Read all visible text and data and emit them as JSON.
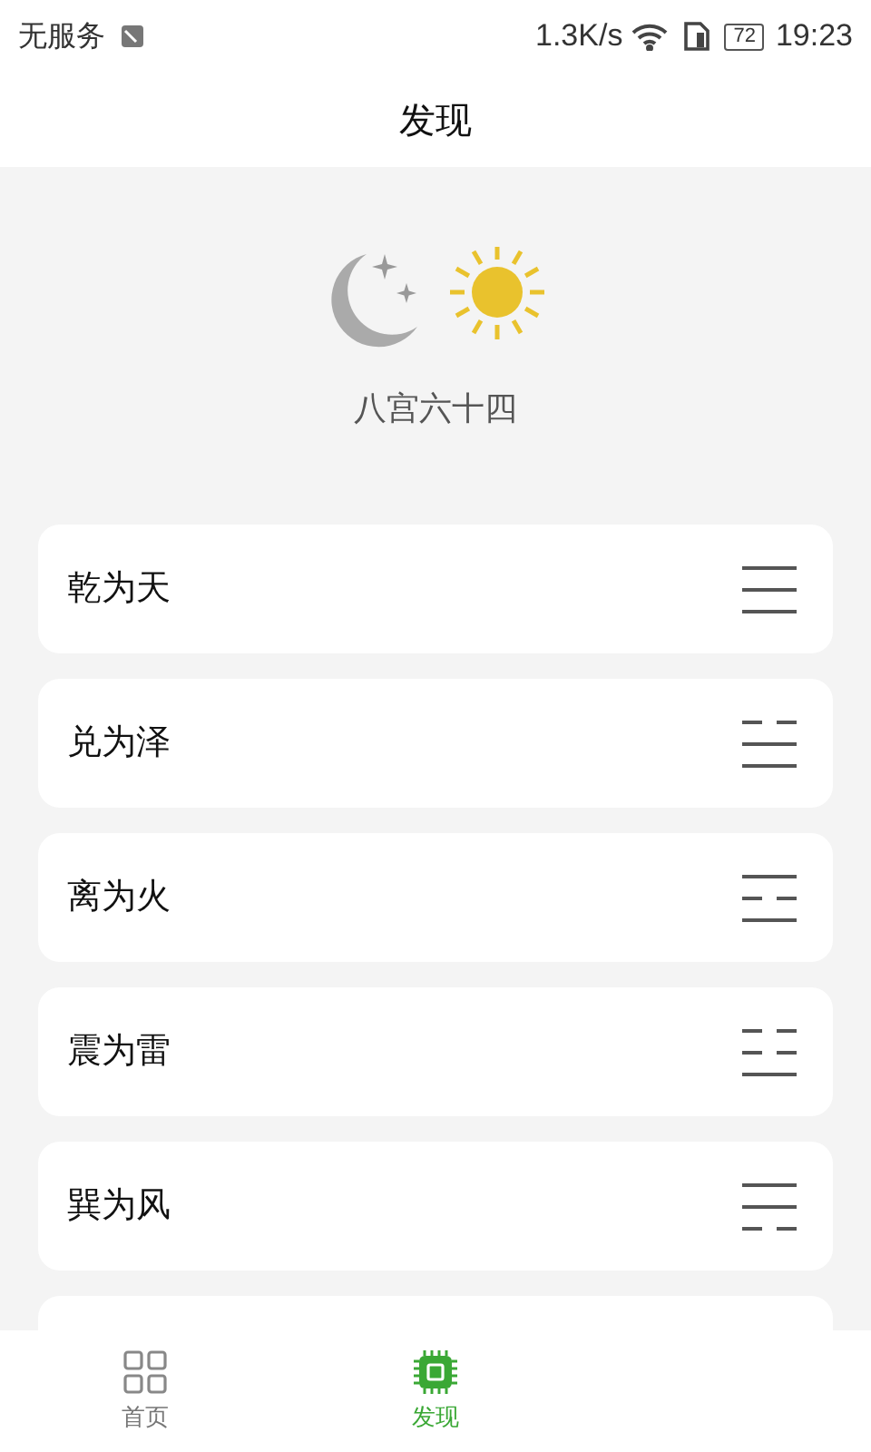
{
  "status_bar": {
    "carrier": "无服务",
    "speed": "1.3K/s",
    "battery": "72",
    "time": "19:23"
  },
  "header": {
    "title": "发现"
  },
  "hero": {
    "caption": "八宫六十四"
  },
  "trigrams": [
    {
      "name": "乾为天",
      "lines": [
        {
          "kind": "yang"
        },
        {
          "kind": "yang"
        },
        {
          "kind": "yang"
        }
      ]
    },
    {
      "name": "兑为泽",
      "lines": [
        {
          "kind": "yin"
        },
        {
          "kind": "yang"
        },
        {
          "kind": "yang"
        }
      ]
    },
    {
      "name": "离为火",
      "lines": [
        {
          "kind": "yang"
        },
        {
          "kind": "yin"
        },
        {
          "kind": "yang"
        }
      ]
    },
    {
      "name": "震为雷",
      "lines": [
        {
          "kind": "yin"
        },
        {
          "kind": "yin"
        },
        {
          "kind": "yang"
        }
      ]
    },
    {
      "name": "巽为风",
      "lines": [
        {
          "kind": "yang"
        },
        {
          "kind": "yang"
        },
        {
          "kind": "yin"
        }
      ]
    }
  ],
  "nav": [
    {
      "label": "首页",
      "kind": "grid",
      "selected": false
    },
    {
      "label": "发现",
      "kind": "chip",
      "selected": true
    }
  ]
}
